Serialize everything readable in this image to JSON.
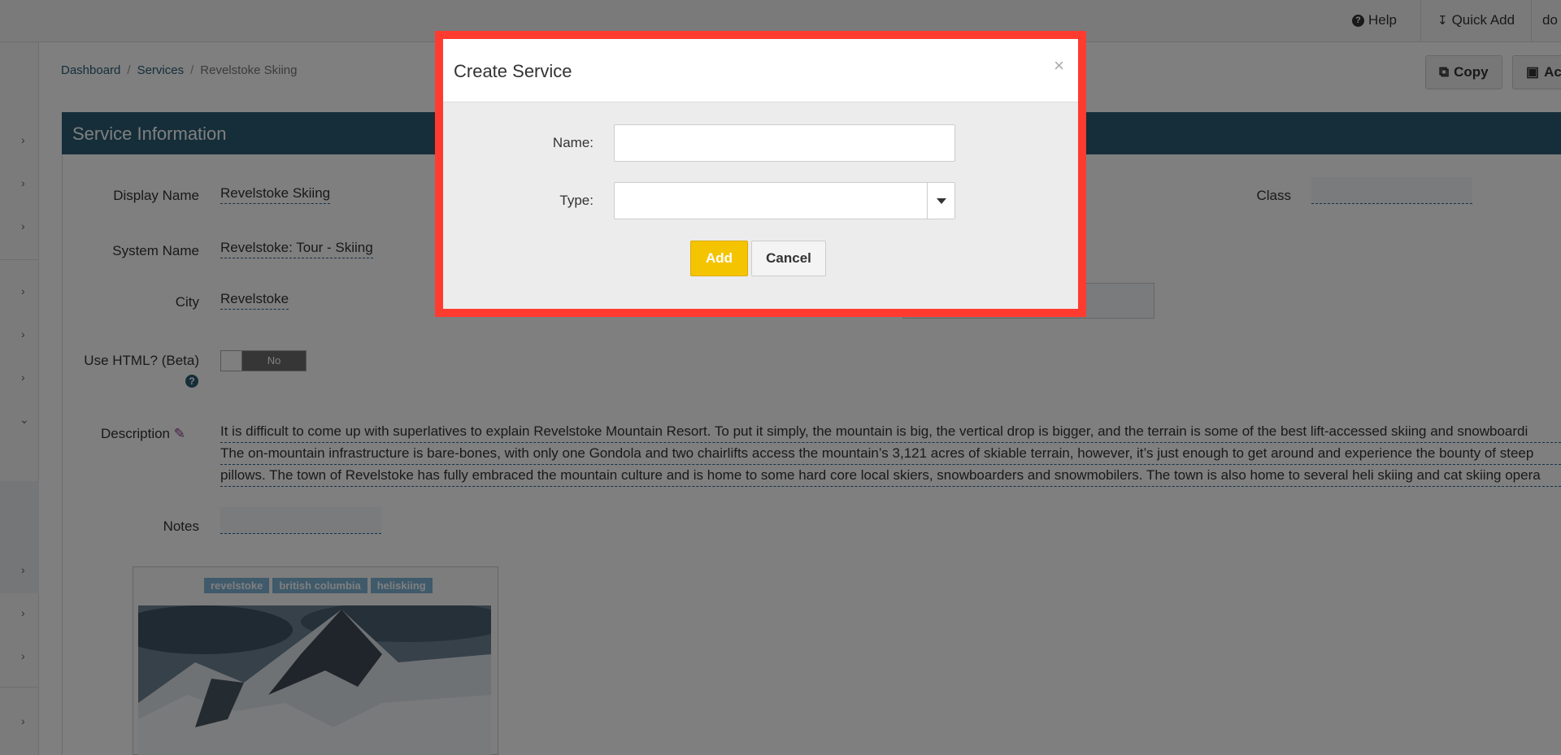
{
  "topbar": {
    "help_label": "Help",
    "quick_add_label": "Quick Add",
    "user_label": "do"
  },
  "breadcrumb": {
    "items": [
      "Dashboard",
      "Services",
      "Revelstoke Skiing"
    ]
  },
  "actions": {
    "copy_label": "Copy",
    "image_label": "Ac"
  },
  "panel": {
    "title": "Service Information",
    "fields": {
      "display_name_label": "Display Name",
      "display_name_value": "Revelstoke Skiing",
      "system_name_label": "System Name",
      "system_name_value": "Revelstoke: Tour - Skiing",
      "city_label": "City",
      "city_value": "Revelstoke",
      "use_html_label": "Use HTML? (Beta)",
      "use_html_value": "No",
      "description_label": "Description",
      "description_lines": [
        "It is difficult to come up with superlatives to explain Revelstoke Mountain Resort. To put it simply, the mountain is big, the vertical drop is bigger, and the terrain is some of the best lift-accessed skiing and snowboardi",
        "The on-mountain infrastructure is bare-bones, with only one Gondola and two chairlifts access the mountain’s 3,121 acres of skiable terrain, however, it’s just enough to get around and experience the bounty of steep",
        "pillows. The town of Revelstoke has fully embraced the mountain culture and is home to some hard core local skiers, snowboarders and snowmobilers. The town is also home to several heli skiing and cat skiing opera"
      ],
      "notes_label": "Notes",
      "class_label": "Class"
    },
    "tags": [
      "revelstoke",
      "british columbia",
      "heliskiing"
    ]
  },
  "modal": {
    "title": "Create Service",
    "close_symbol": "×",
    "name_label": "Name:",
    "name_value": "",
    "type_label": "Type:",
    "type_value": "",
    "add_label": "Add",
    "cancel_label": "Cancel"
  },
  "colors": {
    "accent": "#2b5d73",
    "highlight_border": "#ff3b30",
    "add_button": "#f5c400"
  }
}
